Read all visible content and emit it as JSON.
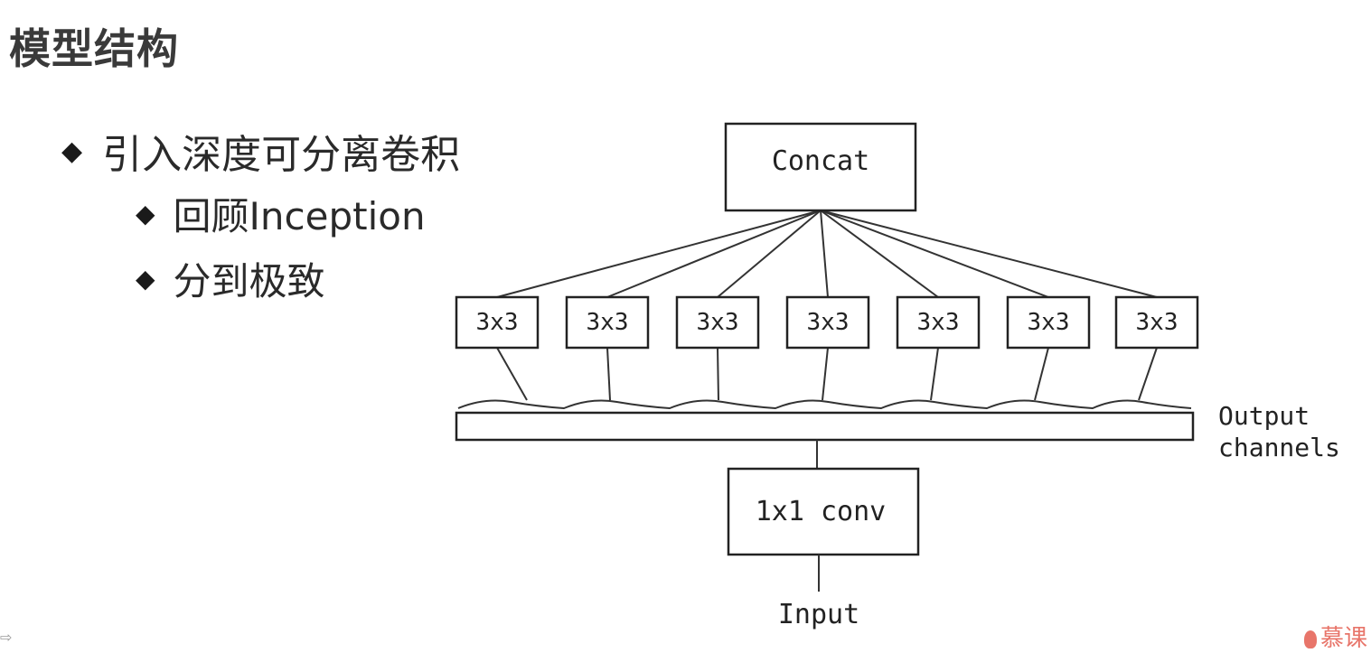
{
  "slide": {
    "title": "模型结构",
    "bullets": [
      {
        "level": 1,
        "text": "引入深度可分离卷积"
      },
      {
        "level": 2,
        "text": "回顾Inception"
      },
      {
        "level": 2,
        "text": "分到极致"
      }
    ],
    "bullet_symbol": "◆"
  },
  "diagram": {
    "concat_label": "Concat",
    "branch_label": "3x3",
    "branch_count": 7,
    "channels_label_line1": "Output",
    "channels_label_line2": "channels",
    "conv_label": "1x1 conv",
    "input_label": "Input"
  },
  "footer": {
    "left_glyph": "⇨",
    "logo_text": "慕课"
  }
}
